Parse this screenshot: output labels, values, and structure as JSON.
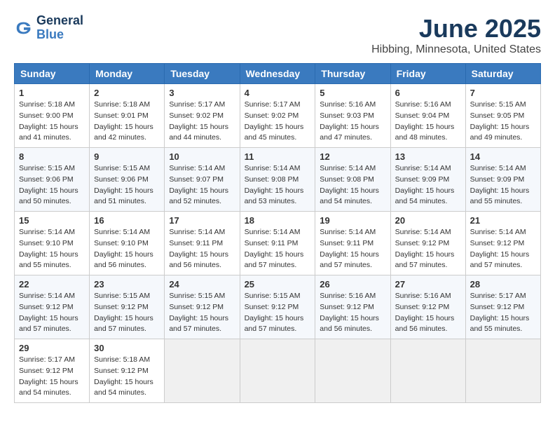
{
  "logo": {
    "general": "General",
    "blue": "Blue"
  },
  "header": {
    "month": "June 2025",
    "location": "Hibbing, Minnesota, United States"
  },
  "weekdays": [
    "Sunday",
    "Monday",
    "Tuesday",
    "Wednesday",
    "Thursday",
    "Friday",
    "Saturday"
  ],
  "weeks": [
    [
      {
        "day": "1",
        "sunrise": "Sunrise: 5:18 AM",
        "sunset": "Sunset: 9:00 PM",
        "daylight": "Daylight: 15 hours and 41 minutes."
      },
      {
        "day": "2",
        "sunrise": "Sunrise: 5:18 AM",
        "sunset": "Sunset: 9:01 PM",
        "daylight": "Daylight: 15 hours and 42 minutes."
      },
      {
        "day": "3",
        "sunrise": "Sunrise: 5:17 AM",
        "sunset": "Sunset: 9:02 PM",
        "daylight": "Daylight: 15 hours and 44 minutes."
      },
      {
        "day": "4",
        "sunrise": "Sunrise: 5:17 AM",
        "sunset": "Sunset: 9:02 PM",
        "daylight": "Daylight: 15 hours and 45 minutes."
      },
      {
        "day": "5",
        "sunrise": "Sunrise: 5:16 AM",
        "sunset": "Sunset: 9:03 PM",
        "daylight": "Daylight: 15 hours and 47 minutes."
      },
      {
        "day": "6",
        "sunrise": "Sunrise: 5:16 AM",
        "sunset": "Sunset: 9:04 PM",
        "daylight": "Daylight: 15 hours and 48 minutes."
      },
      {
        "day": "7",
        "sunrise": "Sunrise: 5:15 AM",
        "sunset": "Sunset: 9:05 PM",
        "daylight": "Daylight: 15 hours and 49 minutes."
      }
    ],
    [
      {
        "day": "8",
        "sunrise": "Sunrise: 5:15 AM",
        "sunset": "Sunset: 9:06 PM",
        "daylight": "Daylight: 15 hours and 50 minutes."
      },
      {
        "day": "9",
        "sunrise": "Sunrise: 5:15 AM",
        "sunset": "Sunset: 9:06 PM",
        "daylight": "Daylight: 15 hours and 51 minutes."
      },
      {
        "day": "10",
        "sunrise": "Sunrise: 5:14 AM",
        "sunset": "Sunset: 9:07 PM",
        "daylight": "Daylight: 15 hours and 52 minutes."
      },
      {
        "day": "11",
        "sunrise": "Sunrise: 5:14 AM",
        "sunset": "Sunset: 9:08 PM",
        "daylight": "Daylight: 15 hours and 53 minutes."
      },
      {
        "day": "12",
        "sunrise": "Sunrise: 5:14 AM",
        "sunset": "Sunset: 9:08 PM",
        "daylight": "Daylight: 15 hours and 54 minutes."
      },
      {
        "day": "13",
        "sunrise": "Sunrise: 5:14 AM",
        "sunset": "Sunset: 9:09 PM",
        "daylight": "Daylight: 15 hours and 54 minutes."
      },
      {
        "day": "14",
        "sunrise": "Sunrise: 5:14 AM",
        "sunset": "Sunset: 9:09 PM",
        "daylight": "Daylight: 15 hours and 55 minutes."
      }
    ],
    [
      {
        "day": "15",
        "sunrise": "Sunrise: 5:14 AM",
        "sunset": "Sunset: 9:10 PM",
        "daylight": "Daylight: 15 hours and 55 minutes."
      },
      {
        "day": "16",
        "sunrise": "Sunrise: 5:14 AM",
        "sunset": "Sunset: 9:10 PM",
        "daylight": "Daylight: 15 hours and 56 minutes."
      },
      {
        "day": "17",
        "sunrise": "Sunrise: 5:14 AM",
        "sunset": "Sunset: 9:11 PM",
        "daylight": "Daylight: 15 hours and 56 minutes."
      },
      {
        "day": "18",
        "sunrise": "Sunrise: 5:14 AM",
        "sunset": "Sunset: 9:11 PM",
        "daylight": "Daylight: 15 hours and 57 minutes."
      },
      {
        "day": "19",
        "sunrise": "Sunrise: 5:14 AM",
        "sunset": "Sunset: 9:11 PM",
        "daylight": "Daylight: 15 hours and 57 minutes."
      },
      {
        "day": "20",
        "sunrise": "Sunrise: 5:14 AM",
        "sunset": "Sunset: 9:12 PM",
        "daylight": "Daylight: 15 hours and 57 minutes."
      },
      {
        "day": "21",
        "sunrise": "Sunrise: 5:14 AM",
        "sunset": "Sunset: 9:12 PM",
        "daylight": "Daylight: 15 hours and 57 minutes."
      }
    ],
    [
      {
        "day": "22",
        "sunrise": "Sunrise: 5:14 AM",
        "sunset": "Sunset: 9:12 PM",
        "daylight": "Daylight: 15 hours and 57 minutes."
      },
      {
        "day": "23",
        "sunrise": "Sunrise: 5:15 AM",
        "sunset": "Sunset: 9:12 PM",
        "daylight": "Daylight: 15 hours and 57 minutes."
      },
      {
        "day": "24",
        "sunrise": "Sunrise: 5:15 AM",
        "sunset": "Sunset: 9:12 PM",
        "daylight": "Daylight: 15 hours and 57 minutes."
      },
      {
        "day": "25",
        "sunrise": "Sunrise: 5:15 AM",
        "sunset": "Sunset: 9:12 PM",
        "daylight": "Daylight: 15 hours and 57 minutes."
      },
      {
        "day": "26",
        "sunrise": "Sunrise: 5:16 AM",
        "sunset": "Sunset: 9:12 PM",
        "daylight": "Daylight: 15 hours and 56 minutes."
      },
      {
        "day": "27",
        "sunrise": "Sunrise: 5:16 AM",
        "sunset": "Sunset: 9:12 PM",
        "daylight": "Daylight: 15 hours and 56 minutes."
      },
      {
        "day": "28",
        "sunrise": "Sunrise: 5:17 AM",
        "sunset": "Sunset: 9:12 PM",
        "daylight": "Daylight: 15 hours and 55 minutes."
      }
    ],
    [
      {
        "day": "29",
        "sunrise": "Sunrise: 5:17 AM",
        "sunset": "Sunset: 9:12 PM",
        "daylight": "Daylight: 15 hours and 54 minutes."
      },
      {
        "day": "30",
        "sunrise": "Sunrise: 5:18 AM",
        "sunset": "Sunset: 9:12 PM",
        "daylight": "Daylight: 15 hours and 54 minutes."
      },
      null,
      null,
      null,
      null,
      null
    ]
  ]
}
